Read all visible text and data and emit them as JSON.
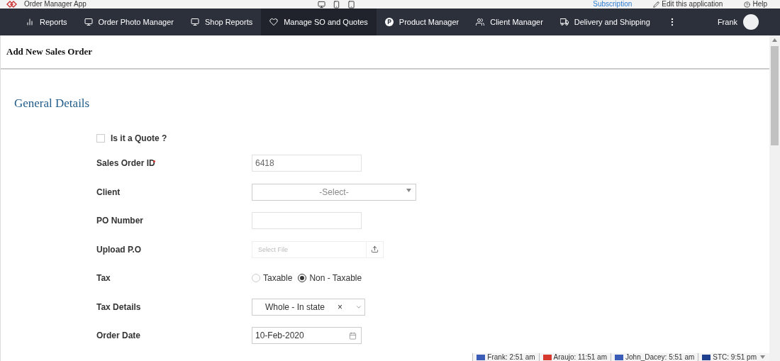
{
  "app": {
    "title": "Order Manager App",
    "links": [
      {
        "label": "Subscription",
        "kind": "link"
      },
      {
        "label": "Edit this application",
        "kind": "edit"
      },
      {
        "label": "Help",
        "kind": "help"
      }
    ]
  },
  "nav": {
    "items": [
      {
        "label": "Reports",
        "selected": false
      },
      {
        "label": "Order Photo Manager",
        "selected": false
      },
      {
        "label": "Shop Reports",
        "selected": false
      },
      {
        "label": "Manage SO and Quotes",
        "selected": true
      },
      {
        "label": "Product Manager",
        "selected": false
      },
      {
        "label": "Client Manager",
        "selected": false
      },
      {
        "label": "Delivery and Shipping",
        "selected": false
      }
    ],
    "user": "Frank"
  },
  "page_title": "Add New Sales Order",
  "section_title": "General Details",
  "fields": [
    {
      "kind": "checkbox",
      "label": "Is it a Quote ?",
      "checked": false
    },
    {
      "kind": "text",
      "label": "Sales Order ID",
      "required": true,
      "value": "6418"
    },
    {
      "kind": "select",
      "label": "Client",
      "value": "-Select-"
    },
    {
      "kind": "text",
      "label": "PO Number",
      "required": false
    },
    {
      "kind": "file",
      "label": "Upload P.O",
      "placeholder": "Select File"
    },
    {
      "kind": "radio",
      "label": "Tax",
      "options": [
        {
          "label": "Taxable",
          "selected": false
        },
        {
          "label": "Non - Taxable",
          "selected": true
        }
      ]
    },
    {
      "kind": "clearable",
      "label": "Tax Details",
      "value": "Whole - In state",
      "clear": "×"
    },
    {
      "kind": "date",
      "label": "Order Date",
      "value": "10-Feb-2020"
    }
  ],
  "clocks": [
    {
      "label": "Frank: 2:51 am",
      "color": "#3b5db8"
    },
    {
      "label": "Araujo: 11:51 am",
      "color": "#d63a2f"
    },
    {
      "label": "John_Dacey: 5:51 am",
      "color": "#3b5db8"
    },
    {
      "label": "STC: 9:51 pm",
      "color": "#1f3f8f"
    }
  ]
}
